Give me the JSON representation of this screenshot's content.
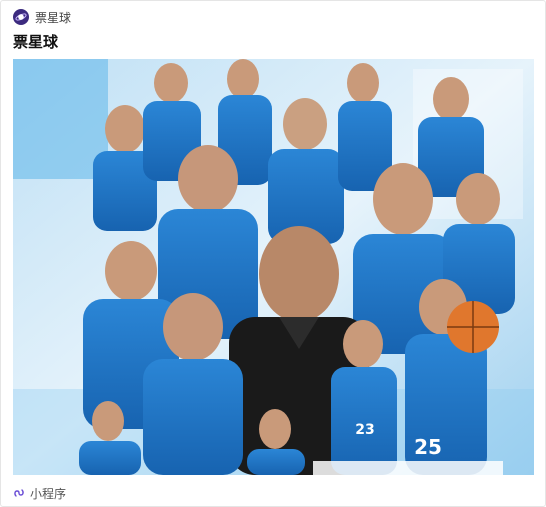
{
  "source": {
    "name": "票星球",
    "icon": "planet-logo-icon"
  },
  "card": {
    "title": "票星球",
    "image_alt": "team-poster-image"
  },
  "jersey_numbers": [
    "23",
    "25"
  ],
  "footer": {
    "label": "小程序",
    "icon": "mini-program-link-icon"
  },
  "colors": {
    "brand": "#3c2b7f",
    "jersey_blue": "#1f74c9",
    "coach_black": "#1a1a1a",
    "background_light": "#d7ecf8"
  }
}
